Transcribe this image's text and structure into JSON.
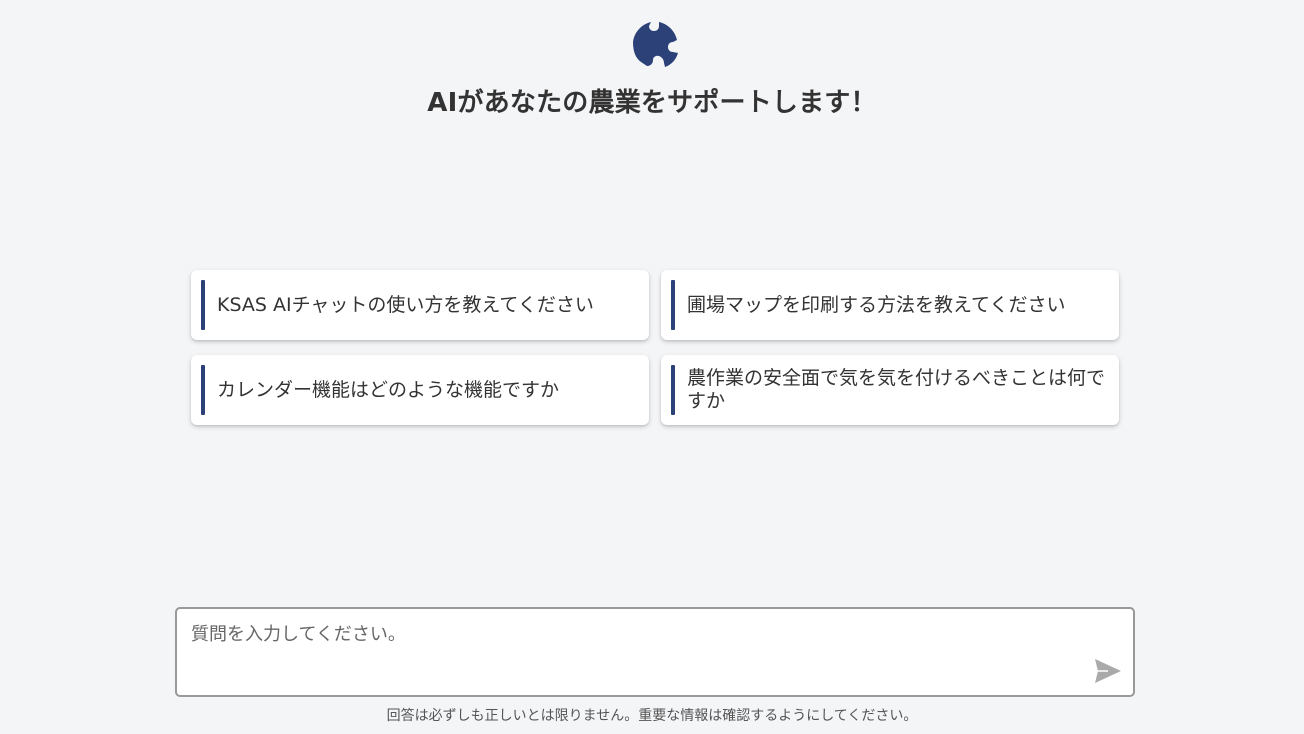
{
  "header": {
    "logo_icon": "puzzle-logo-icon",
    "title": "AIがあなたの農業をサポートします！"
  },
  "suggestions": [
    {
      "label": "KSAS AIチャットの使い方を教えてください"
    },
    {
      "label": "圃場マップを印刷する方法を教えてください"
    },
    {
      "label": "カレンダー機能はどのような機能ですか"
    },
    {
      "label": "農作業の安全面で気を気を付けるべきことは何ですか"
    }
  ],
  "chat_input": {
    "placeholder": "質問を入力してください。",
    "value": "",
    "send_icon": "send-icon"
  },
  "footer": {
    "disclaimer": "回答は必ずしも正しいとは限りません。重要な情報は確認するようにしてください。"
  },
  "colors": {
    "accent": "#2b4178",
    "background": "#f4f5f7",
    "send_icon": "#aaaaaa"
  }
}
